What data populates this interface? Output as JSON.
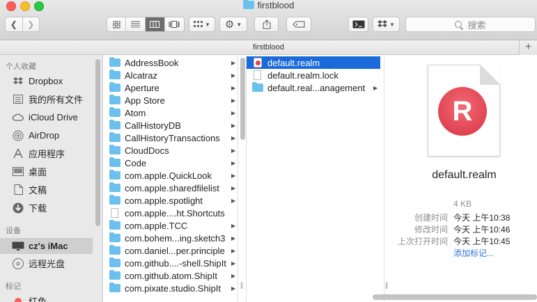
{
  "window": {
    "title": "firstblood"
  },
  "toolbar": {
    "back_icon": "chevron-left-icon",
    "forward_icon": "chevron-right-icon",
    "view_icons": [
      "icon-view-icon",
      "list-view-icon",
      "column-view-icon",
      "cover-flow-view-icon"
    ],
    "active_view": "column",
    "search_placeholder": "搜索"
  },
  "pathbar": {
    "label": "firstblood"
  },
  "sidebar": {
    "sections": [
      {
        "title": "个人收藏",
        "items": [
          "Dropbox",
          "我的所有文件",
          "iCloud Drive",
          "AirDrop",
          "应用程序",
          "桌面",
          "文稿",
          "下载"
        ]
      },
      {
        "title": "设备",
        "items": [
          "cz's iMac",
          "远程光盘"
        ]
      },
      {
        "title": "标记",
        "items": [
          "红色"
        ]
      }
    ],
    "selected": "cz's iMac"
  },
  "column1": [
    {
      "name": "AddressBook",
      "type": "folder"
    },
    {
      "name": "Alcatraz",
      "type": "folder"
    },
    {
      "name": "Aperture",
      "type": "folder"
    },
    {
      "name": "App Store",
      "type": "folder"
    },
    {
      "name": "Atom",
      "type": "folder"
    },
    {
      "name": "CallHistoryDB",
      "type": "folder"
    },
    {
      "name": "CallHistoryTransactions",
      "type": "folder"
    },
    {
      "name": "CloudDocs",
      "type": "folder"
    },
    {
      "name": "Code",
      "type": "folder"
    },
    {
      "name": "com.apple.QuickLook",
      "type": "folder"
    },
    {
      "name": "com.apple.sharedfilelist",
      "type": "folder"
    },
    {
      "name": "com.apple.spotlight",
      "type": "folder"
    },
    {
      "name": "com.apple....ht.Shortcuts",
      "type": "file"
    },
    {
      "name": "com.apple.TCC",
      "type": "folder"
    },
    {
      "name": "com.bohem...ing.sketch3",
      "type": "folder"
    },
    {
      "name": "com.daniel...per.principle",
      "type": "folder"
    },
    {
      "name": "com.github....-shell.ShipIt",
      "type": "folder"
    },
    {
      "name": "com.github.atom.ShipIt",
      "type": "folder"
    },
    {
      "name": "com.pixate.studio.ShipIt",
      "type": "folder"
    }
  ],
  "column2": [
    {
      "name": "default.realm",
      "type": "realm",
      "selected": true
    },
    {
      "name": "default.realm.lock",
      "type": "file"
    },
    {
      "name": "default.real...anagement",
      "type": "folder"
    }
  ],
  "preview": {
    "icon_letter": "R",
    "name": "default.realm",
    "size": "4 KB",
    "info": [
      {
        "label": "创建时间",
        "value": "今天 上午10:38"
      },
      {
        "label": "修改时间",
        "value": "今天 上午10:46"
      },
      {
        "label": "上次打开时间",
        "value": "今天 上午10:45"
      }
    ],
    "add_tags": "添加标记..."
  },
  "colors": {
    "accent": "#1b6ad9",
    "folder": "#6cc0ee",
    "realm": "#e0424e"
  }
}
